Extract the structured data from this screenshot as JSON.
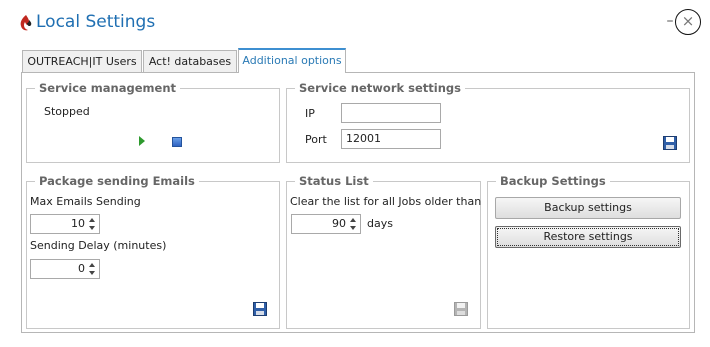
{
  "window": {
    "title": "Local Settings",
    "minimize_glyph": "–",
    "close_glyph": "×"
  },
  "tabs": [
    {
      "label": "OUTREACH|IT Users"
    },
    {
      "label": "Act! databases"
    },
    {
      "label": "Additional options"
    }
  ],
  "service_management": {
    "legend": "Service management",
    "status": "Stopped",
    "play_icon": "play-icon",
    "stop_icon": "stop-icon"
  },
  "network": {
    "legend": "Service network settings",
    "ip_label": "IP",
    "ip_value": "",
    "port_label": "Port",
    "port_value": "12001",
    "save_icon": "save-icon"
  },
  "package": {
    "legend": "Package sending Emails",
    "max_label": "Max Emails Sending",
    "max_value": "10",
    "delay_label": "Sending Delay (minutes)",
    "delay_value": "0",
    "save_icon": "save-icon"
  },
  "status_list": {
    "legend": "Status List",
    "clear_label": "Clear the list for all Jobs older than",
    "days_value": "90",
    "days_unit": "days",
    "save_icon": "save-icon-disabled"
  },
  "backup": {
    "legend": "Backup Settings",
    "backup_label": "Backup settings",
    "restore_label": "Restore settings"
  },
  "colors": {
    "accent": "#2a7ab5",
    "logo_red": "#c0281f",
    "play_green": "#2e9a2e",
    "stop_blue": "#2f62c2"
  }
}
